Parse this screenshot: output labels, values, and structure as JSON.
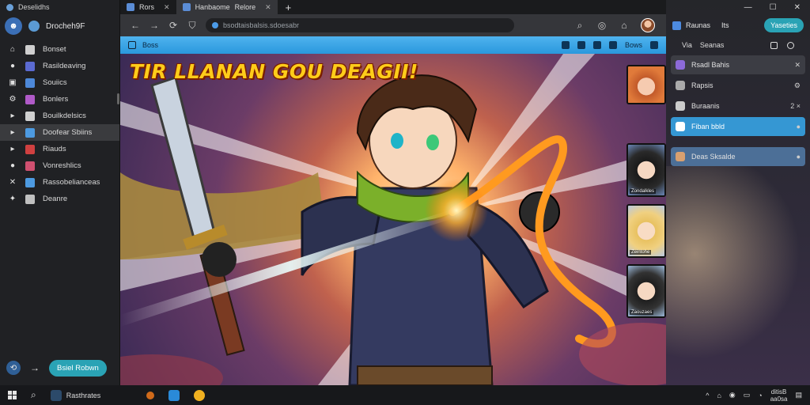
{
  "sidebar": {
    "top_title": "Deselidhs",
    "profile_name": "Drocheh9F",
    "items": [
      {
        "label": "Bonset",
        "glyph": "⌂",
        "color": "#cfcfcf"
      },
      {
        "label": "Rasildeaving",
        "glyph": "●",
        "color": "#5b6ad1"
      },
      {
        "label": "Souiics",
        "glyph": "▣",
        "color": "#4d88d8"
      },
      {
        "label": "Bonlers",
        "glyph": "⚙",
        "color": "#b05ac8"
      },
      {
        "label": "Bouilkdelsics",
        "glyph": "▸",
        "color": "#d0d0d0"
      },
      {
        "label": "Doofear Sbiins",
        "glyph": "▸",
        "color": "#4d9ae0"
      },
      {
        "label": "Riauds",
        "glyph": "▸",
        "color": "#d04040"
      },
      {
        "label": "Vonreshlics",
        "glyph": "●",
        "color": "#d05070"
      },
      {
        "label": "Rassobelianceas",
        "glyph": "✕",
        "color": "#4d9ae0"
      },
      {
        "label": "Deanre",
        "glyph": "✦",
        "color": "#c0c0c0"
      }
    ],
    "bottom_button": "Bsiel Robwn"
  },
  "browser": {
    "tabs": [
      {
        "label": "Rors"
      },
      {
        "label": "Hanbaome"
      },
      {
        "label": "Relore"
      }
    ],
    "url": "bsodtaisbalsis.sdoesabr",
    "bluebar_label": "Boss",
    "bluebar_right": "Bows"
  },
  "artwork": {
    "title": "TIR LLANAN GOU DEAGII!",
    "thumbs": [
      {
        "label": ""
      },
      {
        "label": "Zondalkles"
      },
      {
        "label": "Zeintohe"
      },
      {
        "label": "Zaouzaes"
      }
    ]
  },
  "right_panel": {
    "title": "Raunas",
    "subtitle": "Its",
    "button": "Yaseties",
    "sub_left": "Via",
    "sub_label": "Seanas",
    "items": [
      {
        "label": "Rsadl Bahis",
        "end": "✕",
        "style": "hl",
        "color": "#8c6ad8"
      },
      {
        "label": "Rapsis",
        "end": "⚙",
        "style": "",
        "color": "#aaaaaa"
      },
      {
        "label": "Buraanis",
        "end": "2  ×",
        "style": "",
        "color": "#cccccc"
      },
      {
        "label": "Fiban bbld",
        "end": "●",
        "style": "sel",
        "color": "#ffffff"
      },
      {
        "label": "Deas Sksalde",
        "end": "●",
        "style": "sel2",
        "color": "#d8a070"
      }
    ]
  },
  "taskbar": {
    "app_label": "Rasthrates",
    "clock_time": "ditisB",
    "clock_date": "aa0sa"
  }
}
